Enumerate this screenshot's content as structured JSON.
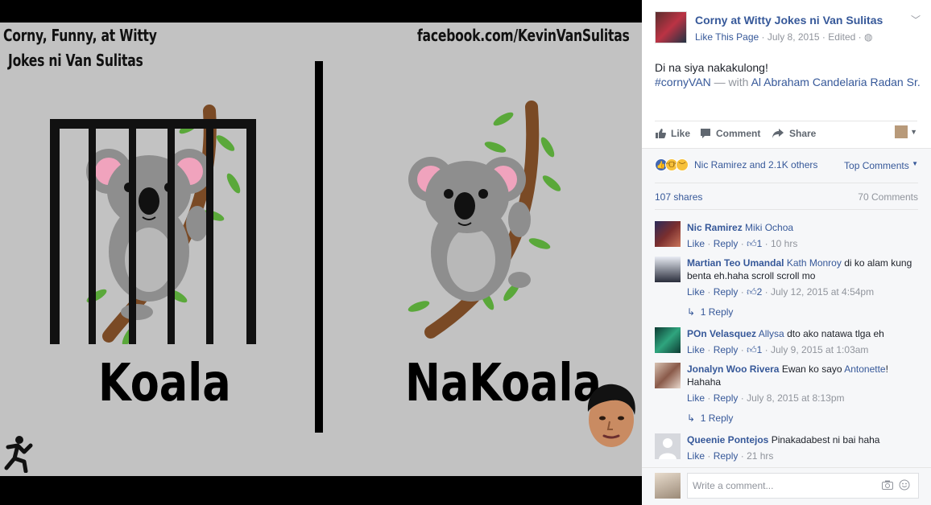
{
  "meme": {
    "caption_line1": "Corny, Funny, at Witty",
    "caption_line2": "Jokes ni Van Sulitas",
    "url": "facebook.com/KevinVanSulitas",
    "left_word": "Koala",
    "right_word": "NaKoala"
  },
  "post": {
    "page_name": "Corny at Witty Jokes ni Van Sulitas",
    "like_page": "Like This Page",
    "date": "July 8, 2015",
    "edited": "Edited",
    "text": "Di na siya nakakulong!",
    "hashtag": "#cornyVAN",
    "with_label": "— with",
    "tagged": "Al Abraham Candelaria Radan Sr."
  },
  "actions": {
    "like": "Like",
    "comment": "Comment",
    "share": "Share"
  },
  "feedback": {
    "reaction_text": "Nic Ramirez and 2.1K others",
    "top_comments": "Top Comments",
    "shares": "107 shares",
    "comments": "70 Comments",
    "write_placeholder": "Write a comment..."
  },
  "comments": [
    {
      "name": "Nic Ramirez",
      "tag": "Miki Ochoa",
      "text": "",
      "likes": "1",
      "time": "10 hrs",
      "reply": "",
      "avatar_color": "#7a2e2e"
    },
    {
      "name": "Martian Teo Umandal",
      "tag": "Kath Monroy",
      "text": "di ko alam kung benta eh.haha scroll scroll mo",
      "likes": "2",
      "time": "July 12, 2015 at 4:54pm",
      "reply": "1 Reply",
      "avatar_color": "#d9dce6"
    },
    {
      "name": "POn Velasquez",
      "tag": "Allysa",
      "text": "dto ako natawa tlga eh",
      "likes": "1",
      "time": "July 9, 2015 at 1:03am",
      "reply": "",
      "avatar_color": "#1f6e5a"
    },
    {
      "name": "Jonalyn Woo Rivera",
      "tag": "",
      "text": "Ewan ko sayo",
      "tag2": "Antonette",
      "text2": "! Hahaha",
      "likes": "",
      "time": "July 8, 2015 at 8:13pm",
      "reply": "1 Reply",
      "avatar_color": "#c9a58d"
    },
    {
      "name": "Queenie Pontejos",
      "tag": "",
      "text": "Pinakadabest ni bai haha",
      "likes": "",
      "time": "21 hrs",
      "reply": "",
      "avatar_color": "#d6d8dd"
    }
  ],
  "labels": {
    "like": "Like",
    "reply": "Reply",
    "dot": "·"
  }
}
